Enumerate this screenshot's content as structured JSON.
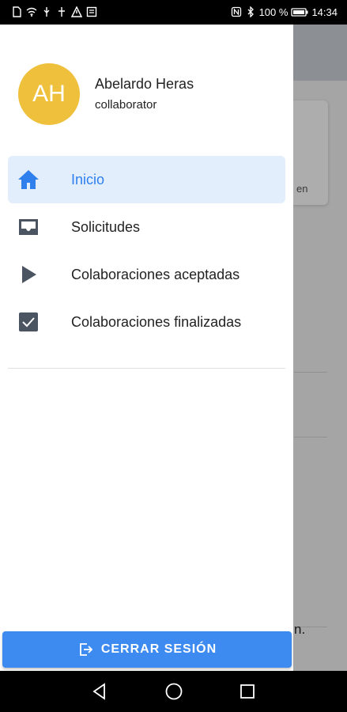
{
  "status_bar": {
    "battery": "100 %",
    "time": "14:34"
  },
  "icons": {
    "home": "home-icon",
    "inbox": "inbox-icon",
    "play": "play-icon",
    "check": "checkbox-icon",
    "logout": "logout-icon"
  },
  "colors": {
    "accent": "#2f80ed",
    "active_background": "#e2eefc",
    "avatar": "#eec03c",
    "button": "#3d8bf0"
  },
  "user": {
    "initials": "AH",
    "name": "Abelardo Heras",
    "role": "collaborator"
  },
  "menu": {
    "items": [
      {
        "label": "Inicio",
        "active": true
      },
      {
        "label": "Solicitudes",
        "active": false
      },
      {
        "label": "Colaboraciones aceptadas",
        "active": false
      },
      {
        "label": "Colaboraciones finalizadas",
        "active": false
      }
    ]
  },
  "logout_label": "CERRAR SESIÓN",
  "background": {
    "card_text": "en",
    "note_text": "n."
  }
}
